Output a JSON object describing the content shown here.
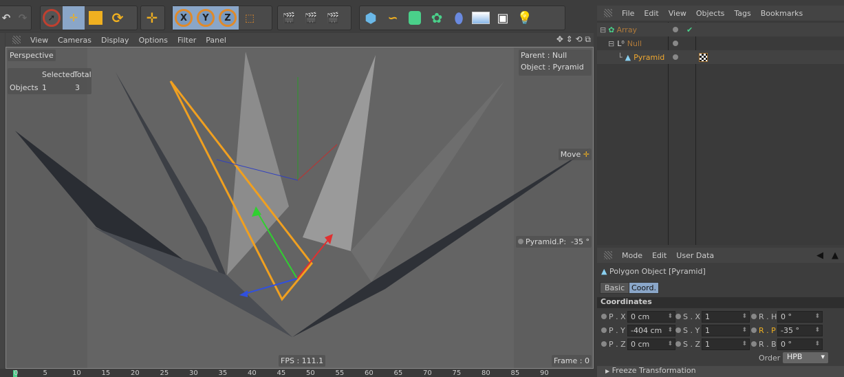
{
  "toolbar": {
    "icons": [
      "undo-icon",
      "redo-icon",
      "select-icon",
      "move-icon",
      "scale-icon",
      "rotate-icon",
      "move-last-icon",
      "x-axis-icon",
      "y-axis-icon",
      "z-axis-icon",
      "coordinate-system-icon",
      "render-view-icon",
      "render-picture-viewer-icon",
      "render-settings-icon",
      "cube-icon",
      "spline-icon",
      "nurbs-icon",
      "array-icon",
      "deformer-icon",
      "floor-icon",
      "camera-icon",
      "light-icon"
    ],
    "x": "X",
    "y": "Y",
    "z": "Z"
  },
  "viewport": {
    "menu": [
      "View",
      "Cameras",
      "Display",
      "Options",
      "Filter",
      "Panel"
    ],
    "camera": "Perspective",
    "stats": {
      "selected": "Selected",
      "total": "Total",
      "label": "Objects",
      "selected_value": "1",
      "total_value": "3"
    },
    "parent": "Parent : Null",
    "object": "Object : Pyramid",
    "tool": "Move",
    "hud_param": "Pyramid.P:",
    "hud_value": "-35 °",
    "fps": "FPS : 111.1",
    "frame": "Frame : 0"
  },
  "object_manager": {
    "menu": [
      "File",
      "Edit",
      "View",
      "Objects",
      "Tags",
      "Bookmarks"
    ],
    "objects": [
      {
        "name": "Array",
        "color": "#b07a3a"
      },
      {
        "name": "Null",
        "color": "#b07a3a"
      },
      {
        "name": "Pyramid",
        "color": "#f0a830"
      }
    ]
  },
  "attributes": {
    "menu": [
      "Mode",
      "Edit",
      "User Data"
    ],
    "title": "Polygon Object [Pyramid]",
    "tabs": [
      "Basic",
      "Coord."
    ],
    "section": "Coordinates",
    "fields": [
      {
        "label": "P . X",
        "value": "0 cm"
      },
      {
        "label": "P . Y",
        "value": "-404 cm"
      },
      {
        "label": "P . Z",
        "value": "0 cm"
      },
      {
        "label": "S . X",
        "value": "1"
      },
      {
        "label": "S . Y",
        "value": "1"
      },
      {
        "label": "S . Z",
        "value": "1"
      },
      {
        "label": "R . H",
        "value": "0 °"
      },
      {
        "label": "R . P",
        "value": "-35 °"
      },
      {
        "label": "R . B",
        "value": "0 °"
      }
    ],
    "order_label": "Order",
    "order_value": "HPB",
    "freeze": "Freeze Transformation"
  },
  "timeline": {
    "ticks": [
      "0",
      "5",
      "10",
      "15",
      "20",
      "25",
      "30",
      "35",
      "40",
      "45",
      "50",
      "55",
      "60",
      "65",
      "70",
      "75",
      "80",
      "85",
      "90"
    ]
  }
}
